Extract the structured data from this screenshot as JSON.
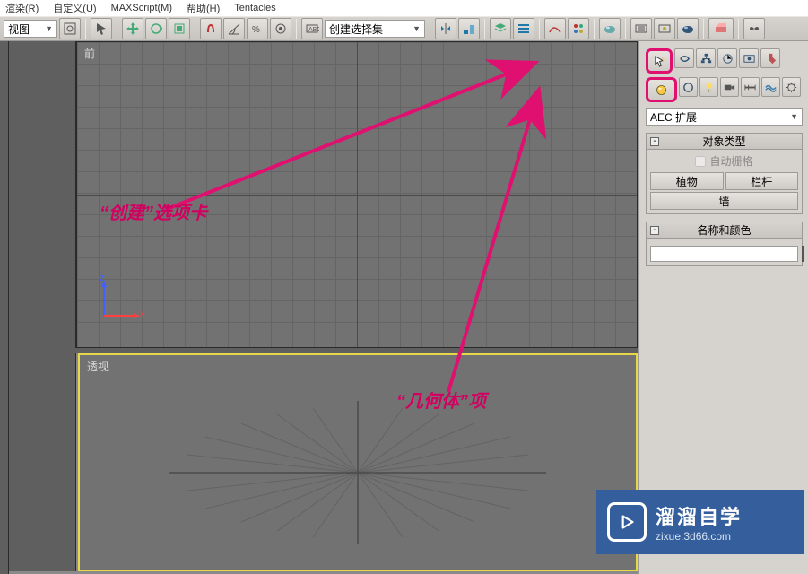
{
  "menu": {
    "item0": "渲染(R)",
    "item1": "自定义(U)",
    "item2": "MAXScript(M)",
    "item3": "帮助(H)",
    "item4": "Tentacles"
  },
  "toolbar": {
    "view_dd": "视图",
    "selset": "创建选择集"
  },
  "viewports": {
    "front": "前",
    "persp": "透视"
  },
  "axis": {
    "x": "x",
    "z": "z"
  },
  "panel": {
    "cat_dd": "AEC 扩展",
    "roll1_title": "对象类型",
    "autogrid": "自动栅格",
    "btn_plant": "植物",
    "btn_rail": "栏杆",
    "btn_wall": "墙",
    "roll2_title": "名称和颜色"
  },
  "callouts": {
    "t1": "“创建”选项卡",
    "t2": "“几何体”项"
  },
  "wm": {
    "big": "溜溜自学",
    "small": "zixue.3d66.com"
  }
}
